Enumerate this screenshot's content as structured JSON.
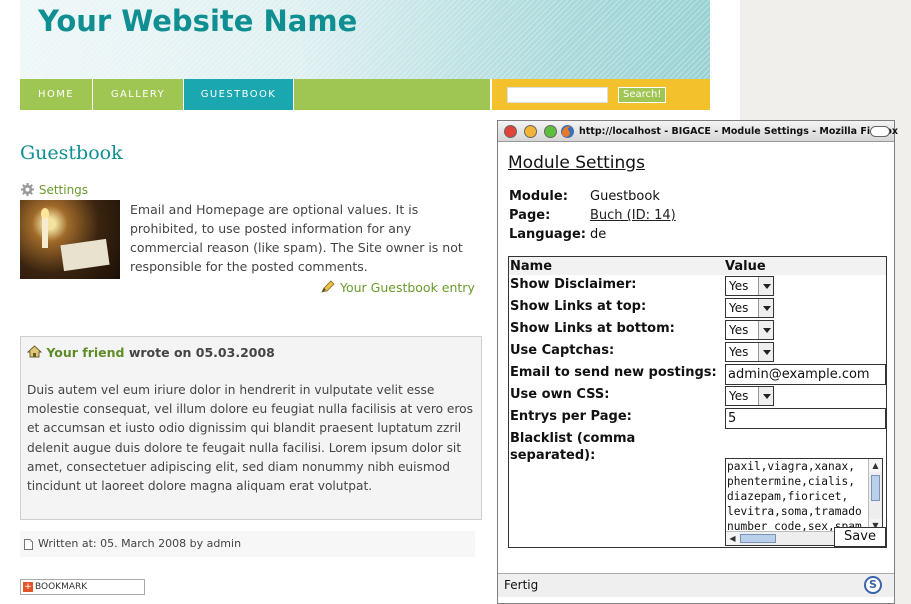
{
  "site": {
    "title": "Your Website Name",
    "nav": [
      {
        "label": "HOME"
      },
      {
        "label": "GALLERY"
      },
      {
        "label": "GUESTBOOK"
      }
    ],
    "search_button": "Search!",
    "page_title": "Guestbook",
    "settings_link": "Settings",
    "intro_text": "Email and Homepage are optional values. It is prohibited, to use posted information for any commercial reason (like spam). The Site owner is not responsible for the posted comments.",
    "entry_link": "Your Guestbook entry",
    "entry": {
      "author": "Your friend",
      "wrote_on": "wrote on 05.03.2008",
      "body": "Duis autem vel eum iriure dolor in hendrerit in vulputate velit esse molestie consequat, vel illum dolore eu feugiat nulla facilisis at vero eros et accumsan et iusto odio dignissim qui blandit praesent luptatum zzril delenit augue duis dolore te feugait nulla facilisi. Lorem ipsum dolor sit amet, consectetuer adipiscing elit, sed diam nonummy nibh euismod tincidunt ut laoreet dolore magna aliquam erat volutpat.",
      "written_at": "Written at: 05. March 2008 by admin"
    },
    "bookmark_label": "BOOKMARK"
  },
  "popup": {
    "window_title": "http://localhost - BIGACE - Module Settings - Mozilla Firefox",
    "heading": "Module Settings",
    "module_label": "Module:",
    "module_value": "Guestbook",
    "page_label": "Page:",
    "page_value": "Buch (ID: 14)",
    "language_label": "Language:",
    "language_value": "de",
    "col_name": "Name",
    "col_value": "Value",
    "rows": [
      {
        "label": "Show Disclaimer:",
        "value": "Yes"
      },
      {
        "label": "Show Links at top:",
        "value": "Yes"
      },
      {
        "label": "Show Links at bottom:",
        "value": "Yes"
      },
      {
        "label": "Use Captchas:",
        "value": "Yes"
      },
      {
        "label": "Email to send new postings:",
        "value": "admin@example.com"
      },
      {
        "label": "Use own CSS:",
        "value": "Yes"
      },
      {
        "label": "Entrys per Page:",
        "value": "5"
      },
      {
        "label": "Blacklist (comma separated):",
        "value": "paxil,viagra,xanax,\nphentermine,cialis,\ndiazepam,fioricet,\nlevitra,soma,tramado\nnumber code,sex,spam"
      }
    ],
    "save_label": "Save",
    "status_text": "Fertig",
    "status_icon": "S"
  },
  "colors": {
    "accent_teal": "#0f8f92",
    "nav_green": "#9fc553",
    "nav_active": "#1aa7b0",
    "search_yellow": "#f2c12b",
    "link_green": "#6a9a2c"
  }
}
